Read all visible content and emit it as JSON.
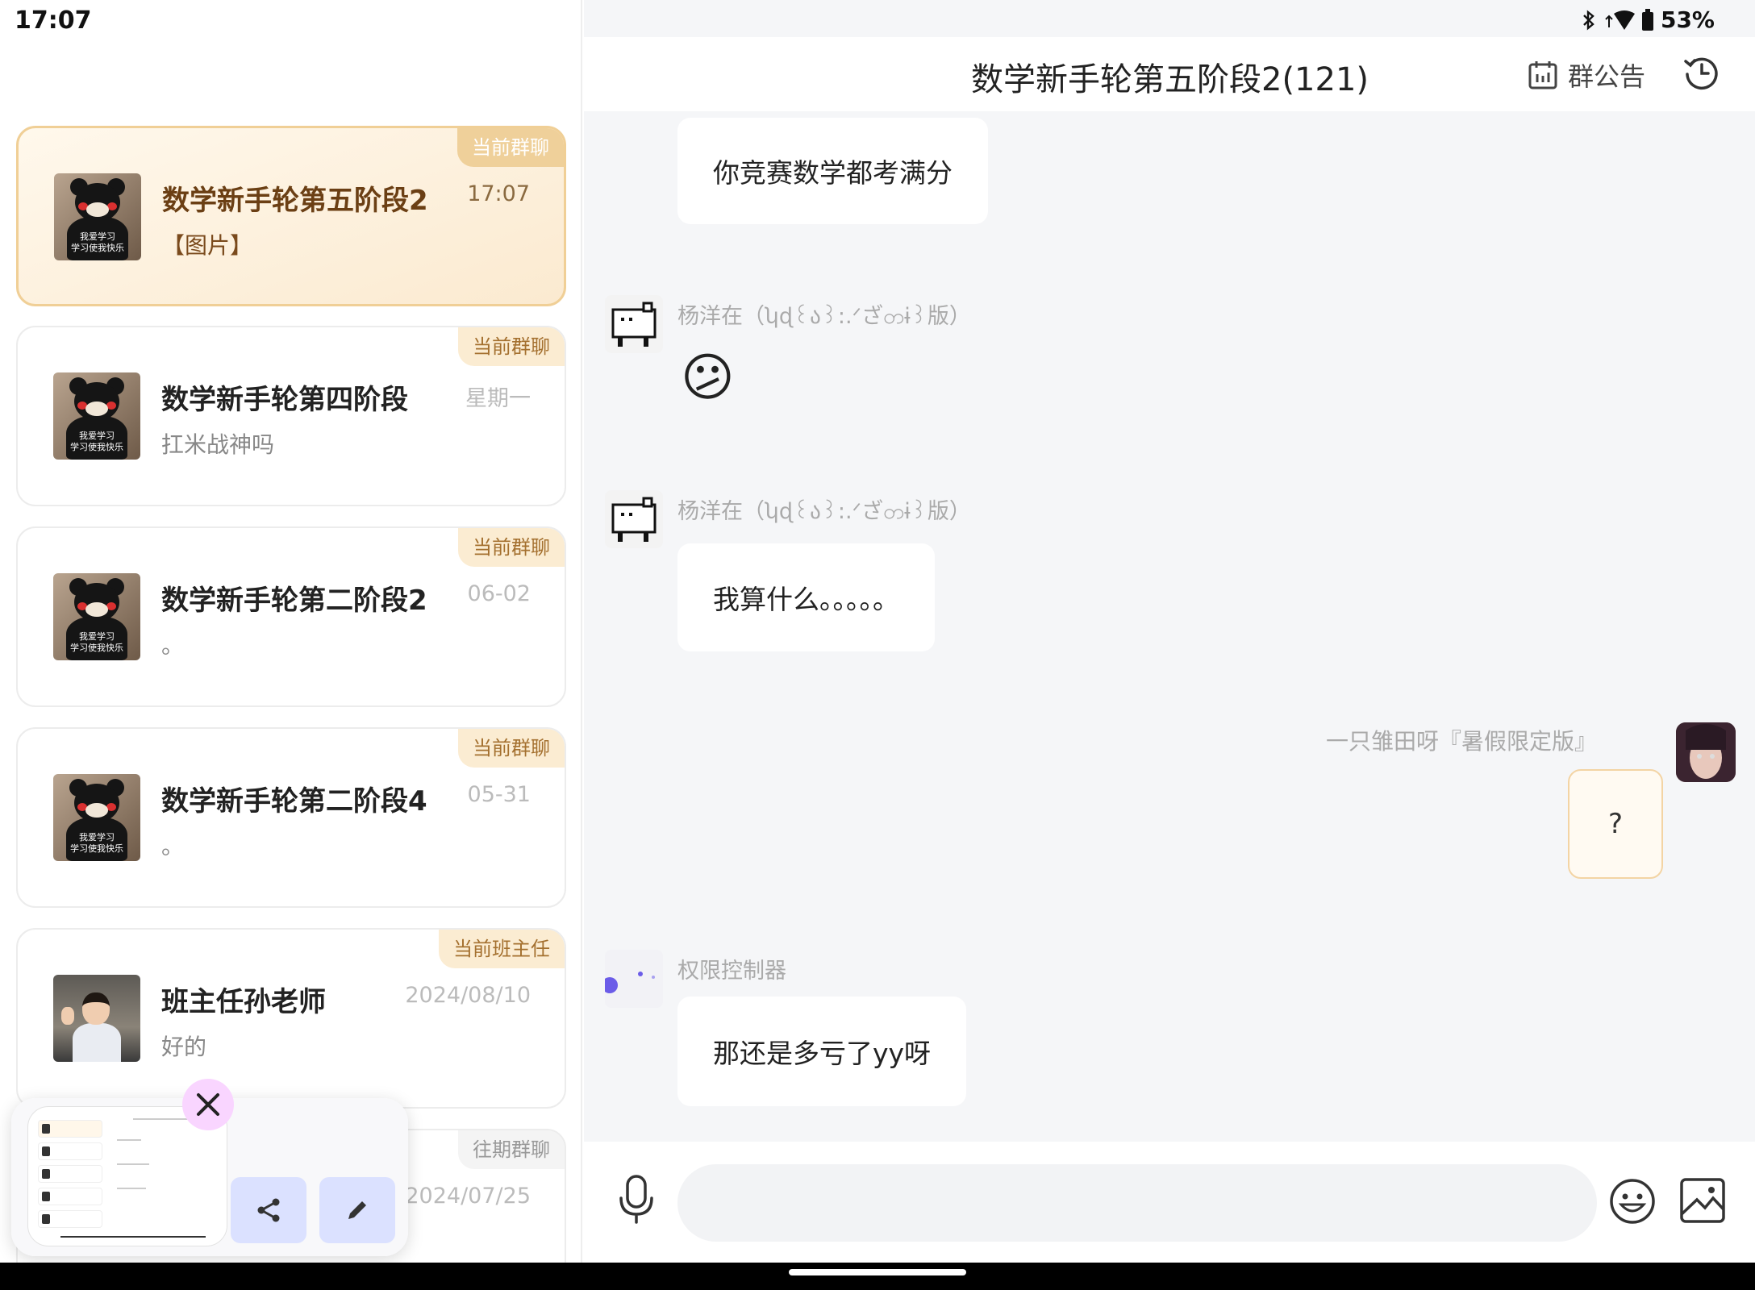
{
  "status_bar": {
    "time": "17:07",
    "battery": "53%"
  },
  "chat_list": [
    {
      "title": "数学新手轮第五阶段2",
      "preview": "【图片】",
      "time": "17:07",
      "tag": "当前群聊",
      "active": true
    },
    {
      "title": "数学新手轮第四阶段",
      "preview": "扛米战神吗",
      "time": "星期一",
      "tag": "当前群聊"
    },
    {
      "title": "数学新手轮第二阶段2",
      "preview": "。",
      "time": "06-02",
      "tag": "当前群聊"
    },
    {
      "title": "数学新手轮第二阶段4",
      "preview": "。",
      "time": "05-31",
      "tag": "当前群聊"
    },
    {
      "title": "班主任孙老师",
      "preview": "好的",
      "time": "2024/08/10",
      "tag": "当前班主任"
    },
    {
      "title": "",
      "preview": "",
      "time": "2024/07/25",
      "tag": "往期群聊"
    }
  ],
  "avatar_caption": {
    "line1": "我爱学习",
    "line2": "学习使我快乐"
  },
  "header": {
    "title": "数学新手轮第五阶段2(121)",
    "announcement_label": "群公告"
  },
  "messages": [
    {
      "sender": "",
      "text": "你竞赛数学都考满分"
    },
    {
      "sender": "杨洋在（ʮɖ꒰ა꒱:.ᐟざတɨ꒱版）",
      "emoji": "😕"
    },
    {
      "sender": "杨洋在（ʮɖ꒰ა꒱:.ᐟざတɨ꒱版）",
      "text": "我算什么。。。。。"
    },
    {
      "sender": "一只雏田呀『暑假限定版』",
      "text": "?",
      "self": true
    },
    {
      "sender": "权限控制器",
      "text": "那还是多亏了yy呀"
    }
  ],
  "input": {
    "placeholder": "",
    "value": ""
  },
  "icons": {
    "mic": "mic-icon",
    "emoji": "emoji-icon",
    "image": "image-icon",
    "history": "history-icon",
    "calendar": "calendar-icon",
    "share": "share-icon",
    "edit": "pencil-icon",
    "close": "close-icon"
  },
  "colors": {
    "accent": "#efd09a",
    "tag_text": "#a4702f",
    "share_bg": "#dbe1ff",
    "close_bg": "#f9d5ff"
  }
}
